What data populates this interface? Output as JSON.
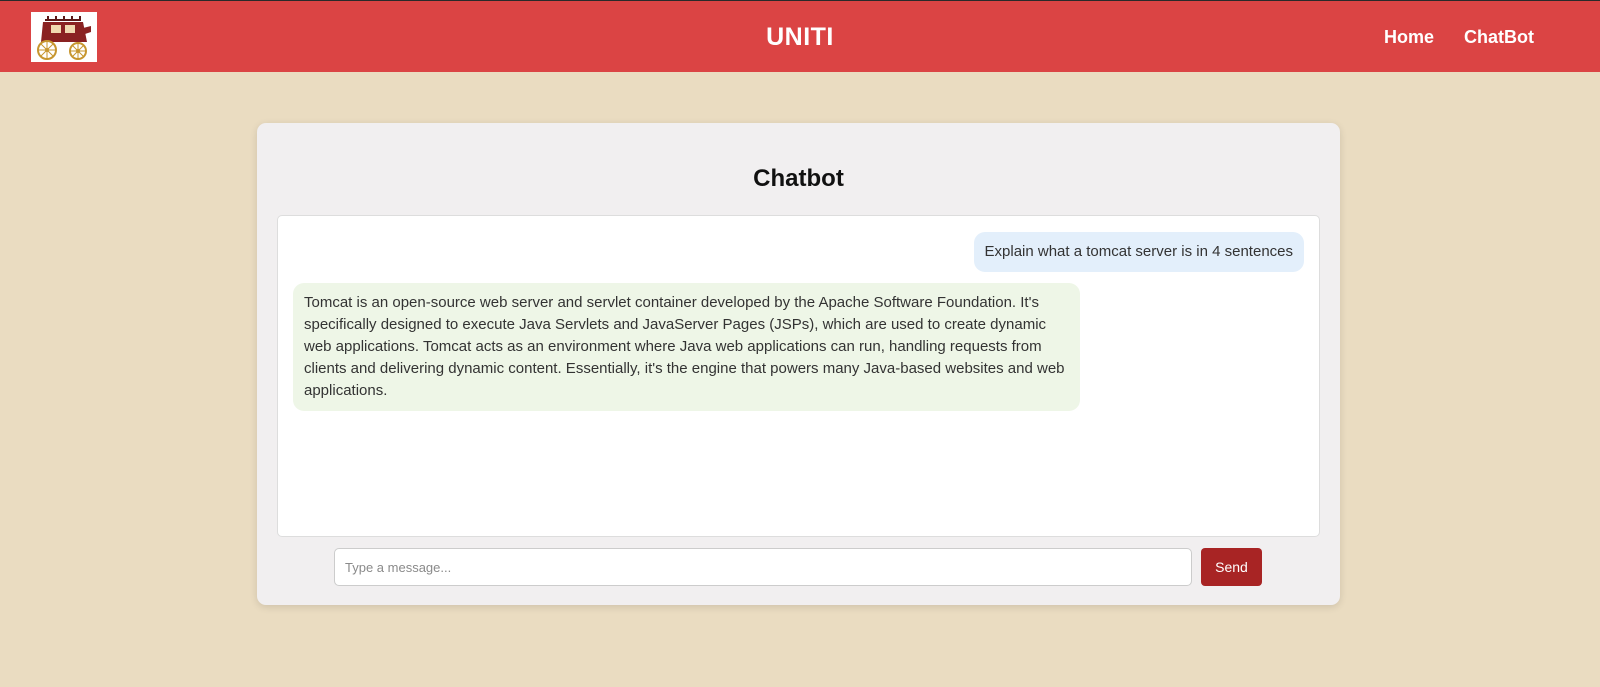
{
  "navbar": {
    "logo_icon": "stagecoach-icon",
    "brand": "UNITI",
    "links": [
      {
        "label": "Home"
      },
      {
        "label": "ChatBot"
      }
    ],
    "color": "#db4444"
  },
  "chat": {
    "title": "Chatbot",
    "messages": [
      {
        "role": "user",
        "text": "Explain what a tomcat server is in 4 sentences"
      },
      {
        "role": "bot",
        "text": "Tomcat is an open-source web server and servlet container developed by the Apache Software Foundation. It's specifically designed to execute Java Servlets and JavaServer Pages (JSPs), which are used to create dynamic web applications. Tomcat acts as an environment where Java web applications can run, handling requests from clients and delivering dynamic content. Essentially, it's the engine that powers many Java-based websites and web applications."
      }
    ],
    "input_placeholder": "Type a message...",
    "input_value": "",
    "send_label": "Send"
  },
  "colors": {
    "page_background": "#eadcc1",
    "send_button": "#a82424",
    "user_bubble": "#e3effb",
    "bot_bubble": "#eef6e7"
  }
}
